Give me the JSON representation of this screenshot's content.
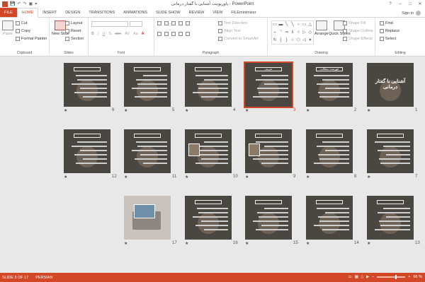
{
  "window": {
    "title": "پاورپوینت آشنایی با گفتار درمانی - PowerPoint",
    "signin": "Sign in",
    "controls": {
      "help": "?",
      "minimize": "–",
      "maximize": "□",
      "close": "✕"
    }
  },
  "qat": {
    "logo": "P",
    "save": "💾",
    "undo": "↶",
    "redo": "↷",
    "start": "▣",
    "more": "▾"
  },
  "tabs": [
    "FILE",
    "HOME",
    "INSERT",
    "DESIGN",
    "TRANSITIONS",
    "ANIMATIONS",
    "SLIDE SHOW",
    "REVIEW",
    "VIEW",
    "FILEminimizer"
  ],
  "ribbon": {
    "clipboard": {
      "paste": "Paste",
      "cut": "Cut",
      "copy": "Copy",
      "format_painter": "Format Painter",
      "label": "Clipboard"
    },
    "slides": {
      "new_slide": "New Slide",
      "layout": "Layout",
      "reset": "Reset",
      "section": "Section",
      "label": "Slides"
    },
    "font": {
      "label": "Font",
      "bold": "B",
      "italic": "I",
      "underline": "U",
      "strike": "S",
      "shadow": "abc",
      "spacing": "AV",
      "case": "Aa",
      "color": "A"
    },
    "paragraph": {
      "text_direction": "Text Direction",
      "align_text": "Align Text",
      "convert": "Convert to SmartArt",
      "label": "Paragraph"
    },
    "drawing": {
      "arrange": "Arrange",
      "quick_styles": "Quick Styles",
      "shape_fill": "Shape Fill",
      "shape_outline": "Shape Outline",
      "shape_effects": "Shape Effects",
      "label": "Drawing",
      "shapes": [
        "▭",
        "▬",
        "╲",
        "╲",
        "○",
        "▭",
        "△",
        "⌐",
        "⌝",
        "⇒",
        "⇓",
        "☆",
        "▷",
        "◇",
        "↻",
        "{",
        "}",
        "☆",
        "⬠",
        "◁",
        "▾"
      ]
    },
    "editing": {
      "find": "Find",
      "replace": "Replace",
      "select": "Select",
      "label": "Editing"
    }
  },
  "slides_row1": [
    {
      "num": "1",
      "kind": "title",
      "title": "آشنایی با گفتار درمانی"
    },
    {
      "num": "2",
      "kind": "text",
      "title": "فهرست مطالب"
    },
    {
      "num": "3",
      "kind": "text",
      "title": "تعریف",
      "selected": true
    },
    {
      "num": "4",
      "kind": "text",
      "title": ""
    },
    {
      "num": "5",
      "kind": "text",
      "title": ""
    },
    {
      "num": "6",
      "kind": "text",
      "title": ""
    }
  ],
  "slides_row2": [
    {
      "num": "7",
      "kind": "text",
      "title": ""
    },
    {
      "num": "8",
      "kind": "text",
      "title": ""
    },
    {
      "num": "9",
      "kind": "text",
      "title": ""
    },
    {
      "num": "10",
      "kind": "text",
      "title": ""
    },
    {
      "num": "11",
      "kind": "text",
      "title": ""
    },
    {
      "num": "12",
      "kind": "text",
      "title": ""
    }
  ],
  "slides_row3": [
    {
      "num": "13",
      "kind": "text",
      "title": ""
    },
    {
      "num": "14",
      "kind": "text",
      "title": ""
    },
    {
      "num": "15",
      "kind": "text",
      "title": ""
    },
    {
      "num": "16",
      "kind": "text",
      "title": ""
    },
    {
      "num": "17",
      "kind": "photo",
      "title": ""
    }
  ],
  "status": {
    "slide_info": "SLIDE 3 OF 17",
    "language": "PERSIAN",
    "zoom": "66 %",
    "zoom_fraction": 0.66,
    "zoom_out": "–",
    "zoom_in": "+"
  }
}
